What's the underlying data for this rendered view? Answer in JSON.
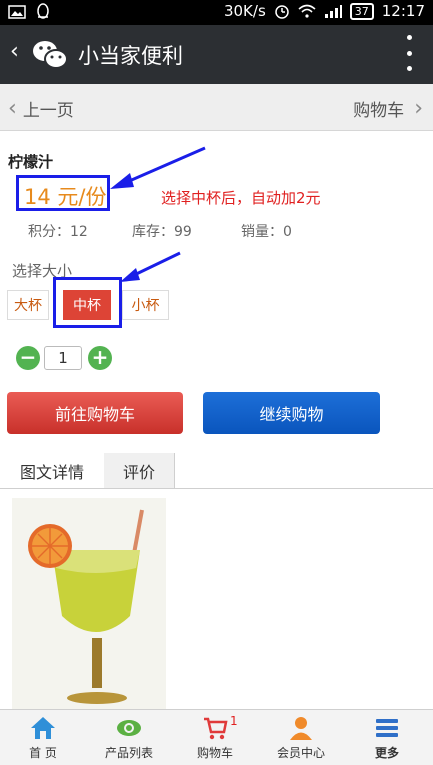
{
  "status": {
    "speed": "30K/s",
    "battery": "37",
    "time": "12:17"
  },
  "header": {
    "title": "小当家便利",
    "back_glyph": "‹"
  },
  "nav": {
    "prev_label": "上一页",
    "cart_label": "购物车"
  },
  "product": {
    "name": "柠檬汁",
    "price": "14 元/份",
    "annotation": "选择中杯后，自动加2元",
    "points": "积分：12",
    "stock": "库存：99",
    "sales": "销量：0",
    "size_label": "选择大小",
    "sizes": [
      "大杯",
      "中杯",
      "小杯"
    ],
    "selected_size": "中杯",
    "quantity": "1",
    "minus": "−",
    "plus": "+",
    "go_cart_label": "前往购物车",
    "continue_label": "继续购物"
  },
  "tabs": [
    "图文详情",
    "评价"
  ],
  "bottom_nav": {
    "items": [
      "首 页",
      "产品列表",
      "购物车",
      "会员中心",
      "更多"
    ],
    "cart_badge": "1"
  },
  "colors": {
    "accent_red": "#dd4436",
    "accent_blue": "#0a55bd",
    "price_orange": "#e78a1c",
    "highlight_blue": "#1a1ee8",
    "green": "#53b351"
  }
}
